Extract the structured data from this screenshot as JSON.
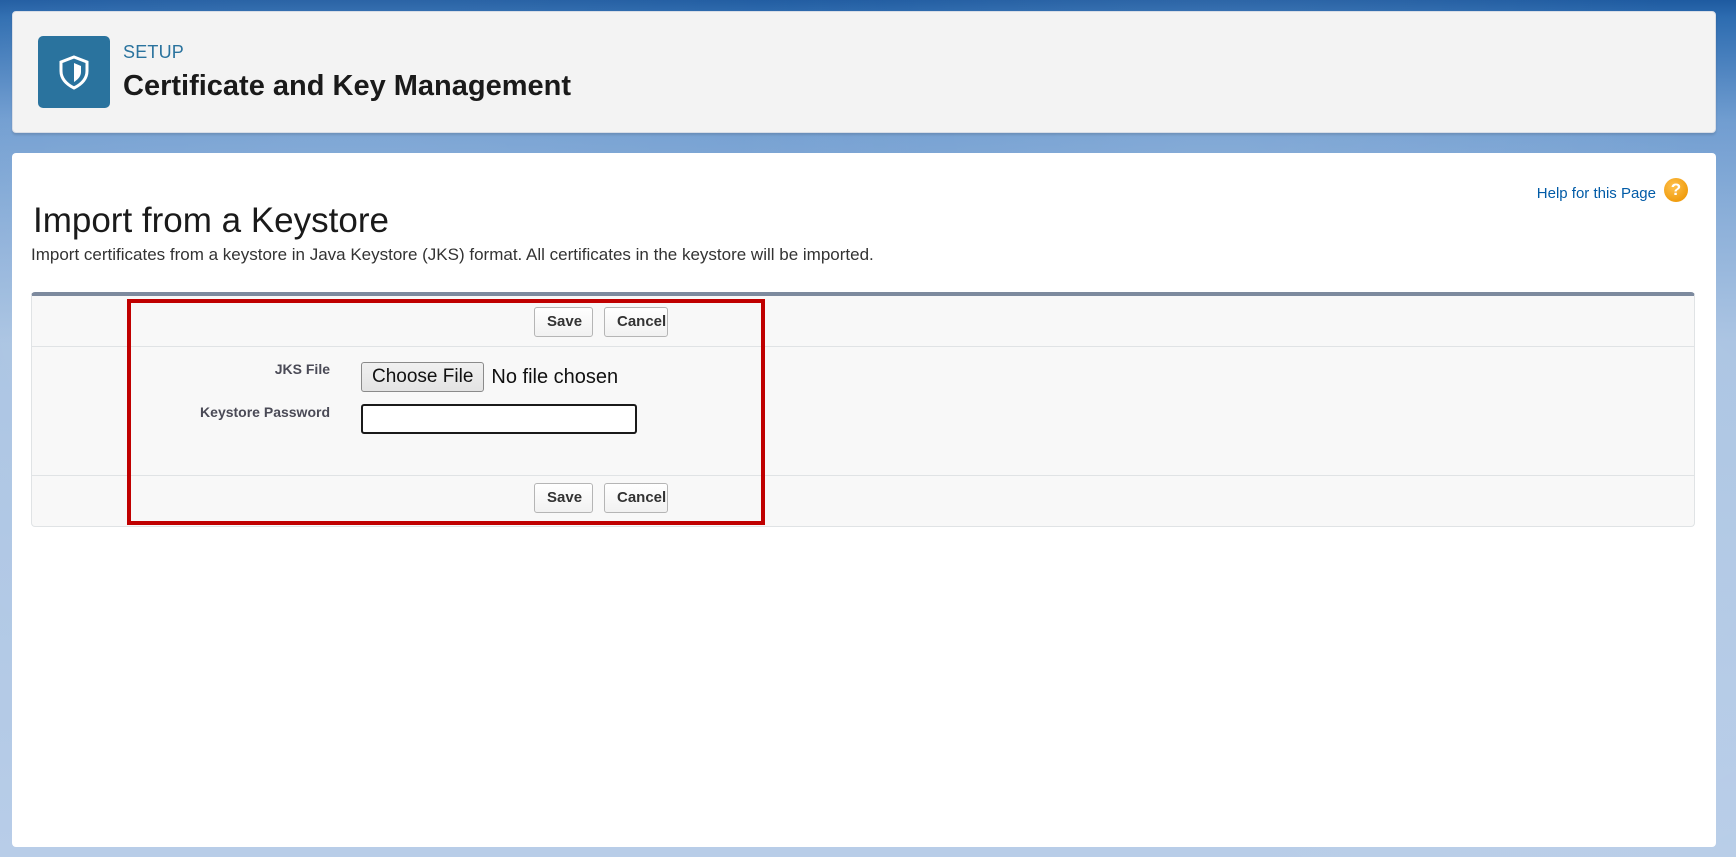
{
  "header": {
    "eyebrow": "SETUP",
    "title": "Certificate and Key Management",
    "icon": "shield-icon"
  },
  "page": {
    "title": "Import from a Keystore",
    "help_link": "Help for this Page",
    "help_icon_glyph": "?",
    "description": "Import certificates from a keystore in Java Keystore (JKS) format. All certificates in the keystore will be imported."
  },
  "form": {
    "top_buttons": {
      "save_label": "Save",
      "cancel_label": "Cancel"
    },
    "bottom_buttons": {
      "save_label": "Save",
      "cancel_label": "Cancel"
    },
    "jks_file": {
      "label": "JKS File",
      "button_label": "Choose File",
      "status": "No file chosen"
    },
    "keystore_password": {
      "label": "Keystore Password",
      "value": ""
    }
  },
  "colors": {
    "brand_icon_bg": "#2a739e",
    "link": "#015ba7",
    "help_icon": "#f09d10",
    "highlight": "#c00000",
    "form_top_border": "#7d8a9e"
  }
}
